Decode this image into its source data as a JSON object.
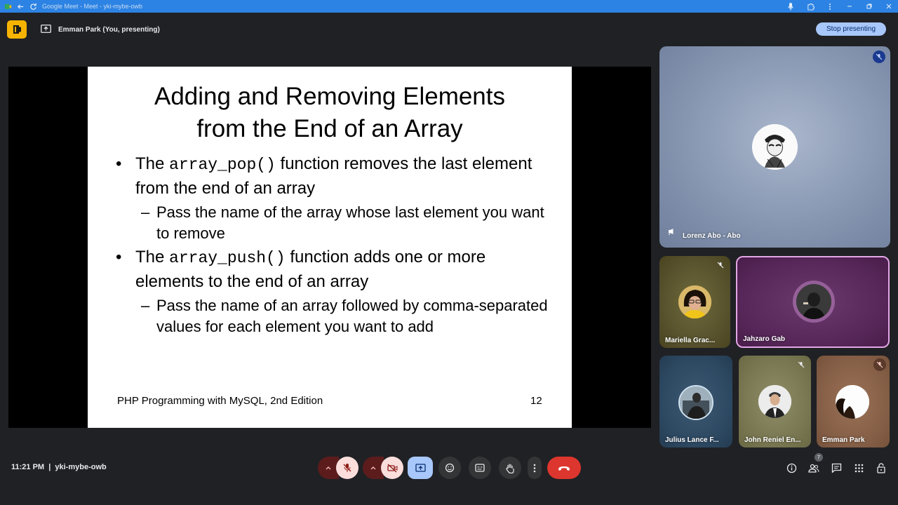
{
  "browser": {
    "title": "Google Meet - Meet - yki-mybe-owb"
  },
  "presenting_bar": {
    "text": "Emman Park (You, presenting)",
    "stop_button": "Stop presenting"
  },
  "slide": {
    "title_line1": "Adding and Removing Elements",
    "title_line2": "from the End of an Array",
    "bullet1_pre": "The ",
    "bullet1_code": "array_pop()",
    "bullet1_post": " function removes the last element from the end of an array",
    "sub1": "Pass the name of the array whose last element you want to remove",
    "bullet2_pre": "The ",
    "bullet2_code": "array_push()",
    "bullet2_post": " function adds one or more elements to the end of an array",
    "sub2": "Pass the name of an array followed by comma-separated values for each element you want to add",
    "footer": "PHP Programming with MySQL, 2nd Edition",
    "page_number": "12",
    "bullet_glyph": "•",
    "dash_glyph": "–"
  },
  "participants": [
    {
      "name": "Lorenz Abo - Abo",
      "muted": true
    },
    {
      "name": "Mariella Grac...",
      "muted": true
    },
    {
      "name": "Jahzaro Gab",
      "muted": false
    },
    {
      "name": "Julius Lance F...",
      "muted": false
    },
    {
      "name": "John Reniel En...",
      "muted": true
    },
    {
      "name": "Emman Park",
      "muted": true
    }
  ],
  "meeting": {
    "time_code": "11:21 PM  |  yki-mybe-owb",
    "people_count": "7"
  },
  "colors": {
    "accent_blue": "#a8c7fa",
    "muted_red": "#f9dedc",
    "end_call": "#dc362e",
    "badge_yellow": "#f6b400"
  }
}
